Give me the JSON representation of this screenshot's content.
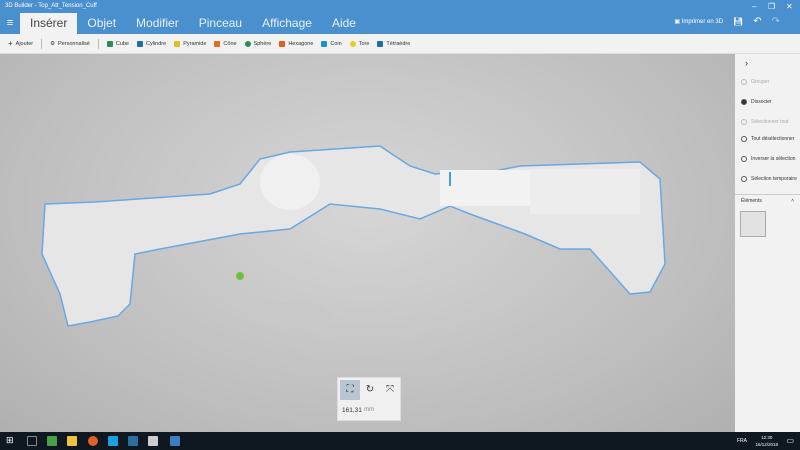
{
  "window": {
    "title": "3D Builder - Top_Att_Tension_Cuff"
  },
  "tabs": [
    {
      "label": "Insérer"
    },
    {
      "label": "Objet"
    },
    {
      "label": "Modifier"
    },
    {
      "label": "Pinceau"
    },
    {
      "label": "Affichage"
    },
    {
      "label": "Aide"
    }
  ],
  "header": {
    "print_label": "Imprimer en 3D"
  },
  "toolbar": {
    "add_label": "Ajouter",
    "custom_label": "Personnalisé",
    "shapes": [
      {
        "label": "Cube",
        "color": "#2e8b57"
      },
      {
        "label": "Cylindre",
        "color": "#1e6fa8"
      },
      {
        "label": "Pyramide",
        "color": "#e0c020"
      },
      {
        "label": "Cône",
        "color": "#e07020"
      },
      {
        "label": "Sphère",
        "color": "#2e8b57"
      },
      {
        "label": "Hexagone",
        "color": "#e06020"
      },
      {
        "label": "Coin",
        "color": "#1e90d0"
      },
      {
        "label": "Tore",
        "color": "#e0d020"
      },
      {
        "label": "Tétraèdre",
        "color": "#1e6fa8"
      }
    ]
  },
  "panel": {
    "items": [
      {
        "label": "Grouper"
      },
      {
        "label": "Dissocier"
      },
      {
        "label": "Sélectionner tout"
      },
      {
        "label": "Tout désélectionner"
      },
      {
        "label": "Inverser la sélection"
      },
      {
        "label": "Sélection temporaire"
      }
    ],
    "elements_label": "Éléments"
  },
  "measure": {
    "value": "161,31",
    "unit": "mm"
  },
  "taskbar": {
    "time": "12:30",
    "date": "16/12/2018",
    "lang": "FRA"
  },
  "colors": {
    "accent": "#4a90cf",
    "selection": "#6aa8e0"
  }
}
